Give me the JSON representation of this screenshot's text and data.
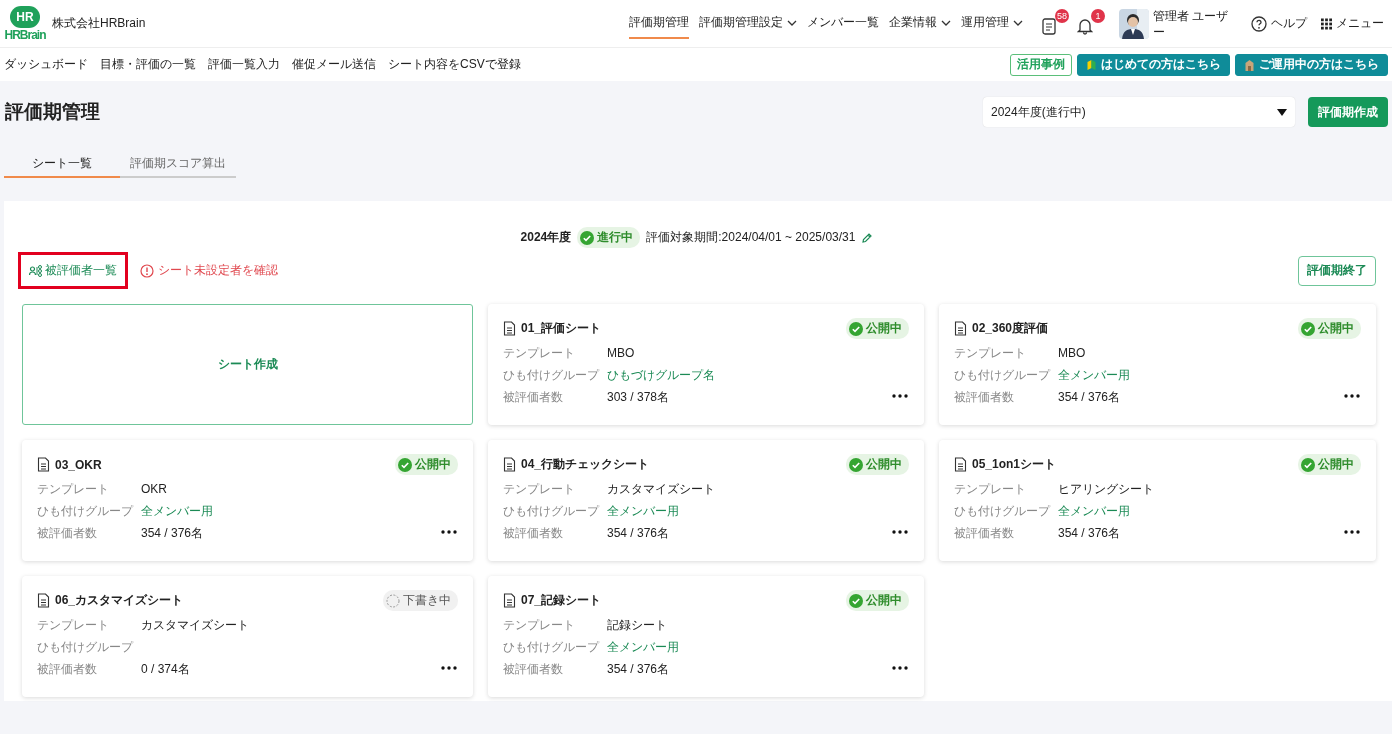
{
  "header": {
    "logo": {
      "mark": "HR",
      "wordmark": "HRBrain"
    },
    "company": "株式会社HRBrain",
    "nav": [
      {
        "label": "評価期管理",
        "selected": true,
        "dropdown": false
      },
      {
        "label": "評価期管理設定",
        "selected": false,
        "dropdown": true
      },
      {
        "label": "メンバー一覧",
        "selected": false,
        "dropdown": false
      },
      {
        "label": "企業情報",
        "selected": false,
        "dropdown": true
      },
      {
        "label": "運用管理",
        "selected": false,
        "dropdown": true
      }
    ],
    "notifications": [
      {
        "kind": "clipboard",
        "count": "58"
      },
      {
        "kind": "bell",
        "count": "1"
      }
    ],
    "user": {
      "name": "管理者 ユーザー"
    },
    "help": "ヘルプ",
    "menu": "メニュー"
  },
  "subnav": {
    "links": [
      "ダッシュボード",
      "目標・評価の一覧",
      "評価一覧入力",
      "催促メール送信",
      "シート内容をCSVで登録"
    ],
    "buttons": [
      {
        "label": "活用事例",
        "kind": "outline"
      },
      {
        "label": "はじめての方はこちら",
        "kind": "beginner"
      },
      {
        "label": "ご運用中の方はこちら",
        "kind": "operating"
      }
    ]
  },
  "page": {
    "title": "評価期管理",
    "period_select": {
      "value": "2024年度(進行中)"
    },
    "create_button": "評価期作成",
    "tabs": [
      {
        "label": "シート一覧",
        "selected": true
      },
      {
        "label": "評価期スコア算出",
        "selected": false
      }
    ]
  },
  "panel": {
    "year": "2024年度",
    "status": "進行中",
    "period": "評価対象期間:2024/04/01 ~ 2025/03/31",
    "evaluatee_link": {
      "label": "被評価者一覧",
      "highlighted": true
    },
    "warning_link": "シート未設定者を確認",
    "end_button": "評価期終了",
    "create_sheet": "シート作成",
    "sheets": [
      {
        "name": "01_評価シート",
        "status": "公開中",
        "kind": "published",
        "template_label": "テンプレート",
        "template": "MBO",
        "group_label": "ひも付けグループ",
        "group": "ひもづけグループ名",
        "count_label": "被評価者数",
        "count": "303 / 378名"
      },
      {
        "name": "02_360度評価",
        "status": "公開中",
        "kind": "published",
        "template_label": "テンプレート",
        "template": "MBO",
        "group_label": "ひも付けグループ",
        "group": "全メンバー用",
        "count_label": "被評価者数",
        "count": "354 / 376名"
      },
      {
        "name": "03_OKR",
        "status": "公開中",
        "kind": "published",
        "template_label": "テンプレート",
        "template": "OKR",
        "group_label": "ひも付けグループ",
        "group": "全メンバー用",
        "count_label": "被評価者数",
        "count": "354 / 376名"
      },
      {
        "name": "04_行動チェックシート",
        "status": "公開中",
        "kind": "published",
        "template_label": "テンプレート",
        "template": "カスタマイズシート",
        "group_label": "ひも付けグループ",
        "group": "全メンバー用",
        "count_label": "被評価者数",
        "count": "354 / 376名"
      },
      {
        "name": "05_1on1シート",
        "status": "公開中",
        "kind": "published",
        "template_label": "テンプレート",
        "template": "ヒアリングシート",
        "group_label": "ひも付けグループ",
        "group": "全メンバー用",
        "count_label": "被評価者数",
        "count": "354 / 376名"
      },
      {
        "name": "06_カスタマイズシート",
        "status": "下書き中",
        "kind": "draft",
        "template_label": "テンプレート",
        "template": "カスタマイズシート",
        "group_label": "ひも付けグループ",
        "count_label": "被評価者数",
        "count": "0 / 374名"
      },
      {
        "name": "07_記録シート",
        "status": "公開中",
        "kind": "published",
        "template_label": "テンプレート",
        "template": "記録シート",
        "group_label": "ひも付けグループ",
        "group": "全メンバー用",
        "count_label": "被評価者数",
        "count": "354 / 376名"
      }
    ]
  }
}
